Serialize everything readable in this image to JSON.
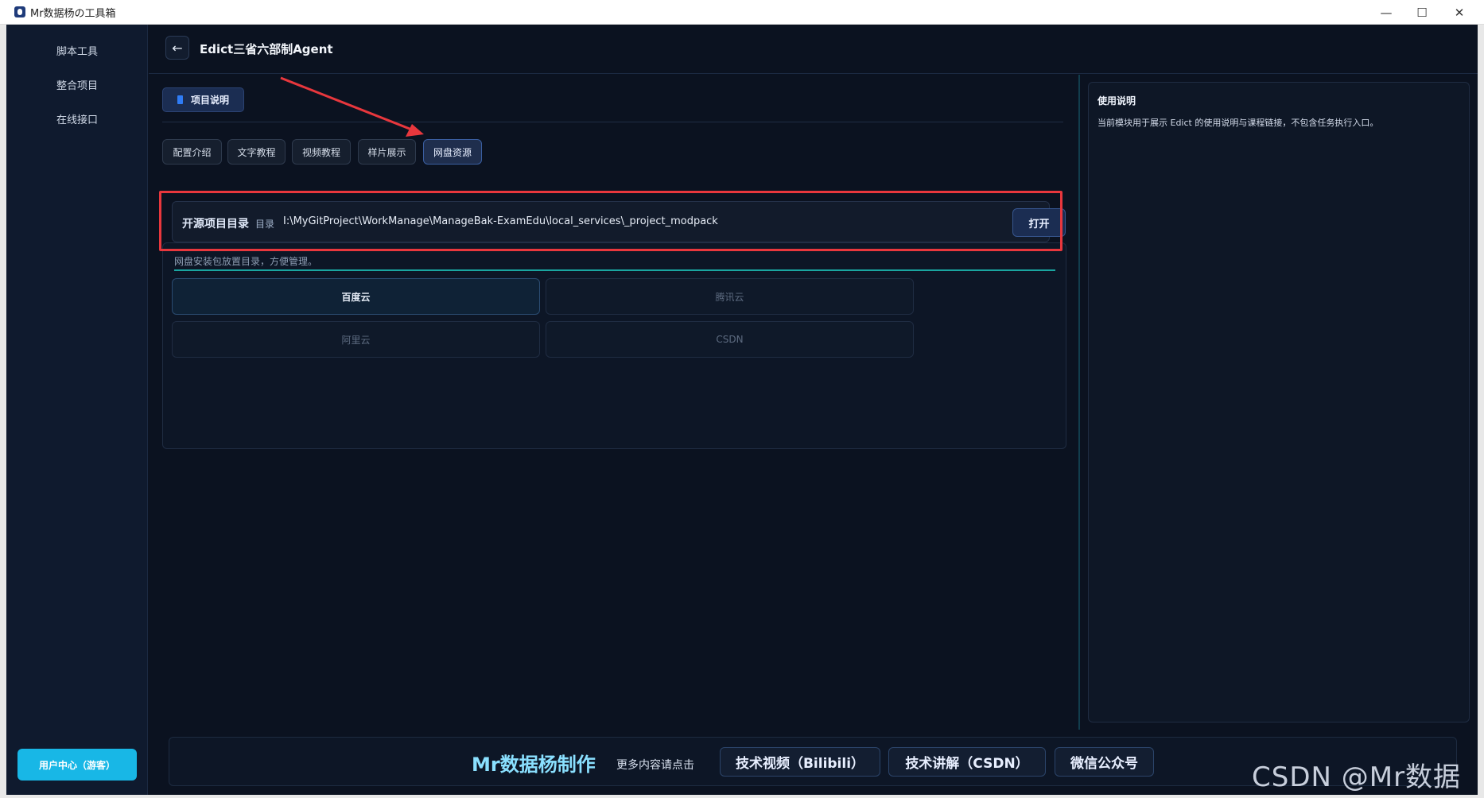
{
  "window": {
    "title": "Mr数据杨の工具箱",
    "minimize": "—",
    "maximize": "☐",
    "close": "✕"
  },
  "sidebar": {
    "items": [
      {
        "label": "脚本工具"
      },
      {
        "label": "整合项目"
      },
      {
        "label": "在线接口"
      }
    ],
    "user_center_label": "用户中心（游客）"
  },
  "header": {
    "back_symbol": "←",
    "title": "Edict三省六部制Agent"
  },
  "main": {
    "project_tab_label": "项目说明",
    "sub_tabs": [
      {
        "label": "配置介绍"
      },
      {
        "label": "文字教程"
      },
      {
        "label": "视频教程"
      },
      {
        "label": "样片展示"
      },
      {
        "label": "网盘资源"
      }
    ],
    "active_sub_tab": "网盘资源",
    "directory": {
      "label": "开源项目目录",
      "sub_label": "目录",
      "path": "I:\\MyGitProject\\WorkManage\\ManageBak-ExamEdu\\local_services\\_project_modpack",
      "open_button": "打开"
    },
    "netdisk": {
      "note": "网盘安装包放置目录，方便管理。",
      "clouds": [
        {
          "label": "百度云"
        },
        {
          "label": "腾讯云"
        },
        {
          "label": "阿里云"
        },
        {
          "label": "CSDN"
        }
      ]
    }
  },
  "info": {
    "title": "使用说明",
    "text": "当前模块用于展示 Edict 的使用说明与课程链接，不包含任务执行入口。"
  },
  "footer": {
    "brand": "Mr数据杨制作",
    "more": "更多内容请点击",
    "buttons": [
      {
        "label": "技术视频（Bilibili）"
      },
      {
        "label": "技术讲解（CSDN）"
      },
      {
        "label": "微信公众号"
      }
    ]
  },
  "watermark": "CSDN @Mr数据杨",
  "colors": {
    "accent": "#18b7e6",
    "annotation_red": "#e8373d",
    "teal_line": "#1aa5a0",
    "background": "#0b1220"
  }
}
